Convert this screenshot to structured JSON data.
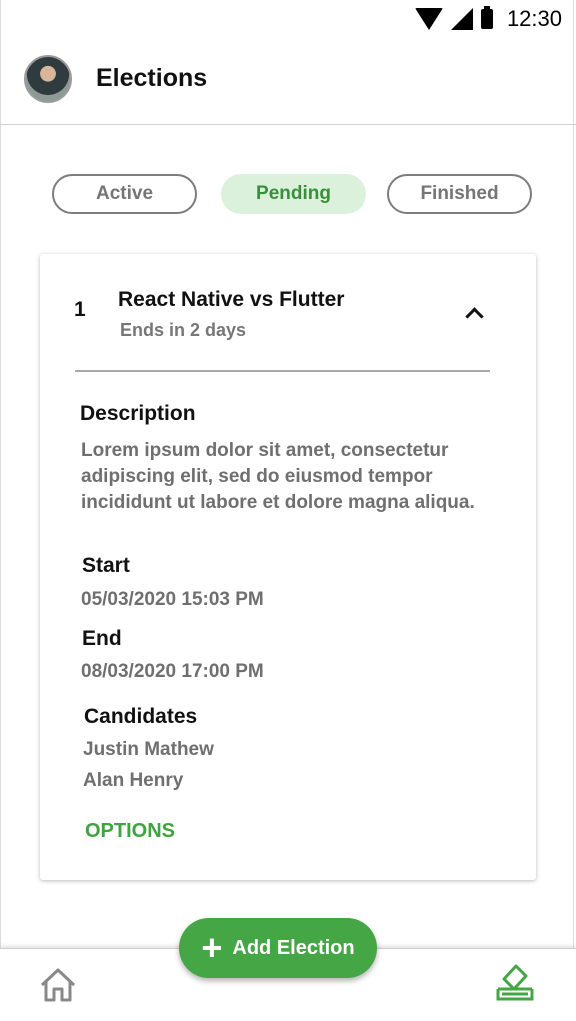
{
  "status_bar": {
    "time": "12:30"
  },
  "header": {
    "title": "Elections"
  },
  "tabs": [
    {
      "label": "Active",
      "selected": false
    },
    {
      "label": "Pending",
      "selected": true
    },
    {
      "label": "Finished",
      "selected": false
    }
  ],
  "election": {
    "number": "1",
    "title": "React Native vs Flutter",
    "ends": "Ends in 2 days",
    "description_label": "Description",
    "description": "Lorem ipsum dolor sit amet, consectetur adipiscing elit, sed do eiusmod tempor incididunt ut labore et dolore magna aliqua.",
    "start_label": "Start",
    "start": "05/03/2020 15:03 PM",
    "end_label": "End",
    "end": "08/03/2020 17:00 PM",
    "candidates_label": "Candidates",
    "candidates": [
      "Justin Mathew",
      "Alan Henry"
    ],
    "options_label": "OPTIONS"
  },
  "fab": {
    "label": "Add Election",
    "icon": "plus-icon"
  },
  "bottom_nav": {
    "left_icon": "home-icon",
    "right_icon": "vote-icon"
  },
  "colors": {
    "accent": "#44a644",
    "pending_bg": "#dcf1dc",
    "options": "#3fa33f"
  }
}
